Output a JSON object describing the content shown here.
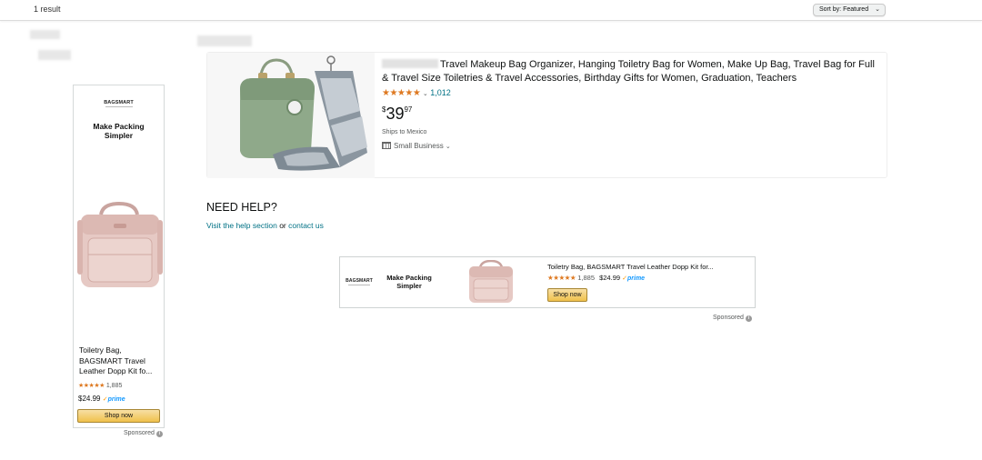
{
  "topbar": {
    "result_count": "1 result",
    "sort_label": "Sort by:",
    "sort_value": "Featured"
  },
  "side_ad": {
    "brand": "BAGSMART",
    "tagline_line1": "Make Packing",
    "tagline_line2": "Simpler",
    "title": "Toiletry Bag, BAGSMART Travel Leather Dopp Kit fo...",
    "rating_count": "1,885",
    "price": "$24.99",
    "prime": "prime",
    "shop_label": "Shop now",
    "sponsored": "Sponsored",
    "rating": 4.5
  },
  "product": {
    "title": "Travel Makeup Bag Organizer, Hanging Toiletry Bag for Women, Make Up Bag, Travel Bag for Full & Travel Size Toiletries & Travel Accessories, Birthday Gifts for Women, Graduation, Teachers",
    "rating_count": "1,012",
    "price_currency": "$",
    "price_whole": "39",
    "price_fraction": "97",
    "shipping": "Ships to Mexico",
    "badge": "Small Business",
    "rating": 4.5
  },
  "help": {
    "heading": "NEED HELP?",
    "prefix": "Visit the help section",
    "joiner": "or",
    "contact": "contact us"
  },
  "bottom_ad": {
    "brand": "BAGSMART",
    "tagline_line1": "Make Packing",
    "tagline_line2": "Simpler",
    "title": "Toiletry Bag, BAGSMART Travel Leather Dopp Kit for...",
    "rating_count": "1,885",
    "price": "$24.99",
    "prime": "prime",
    "shop_label": "Shop now",
    "sponsored": "Sponsored",
    "rating": 4.5
  },
  "colors": {
    "link": "#007185",
    "star": "#de7921",
    "button": "#f0c14b",
    "prime": "#1399ff"
  }
}
